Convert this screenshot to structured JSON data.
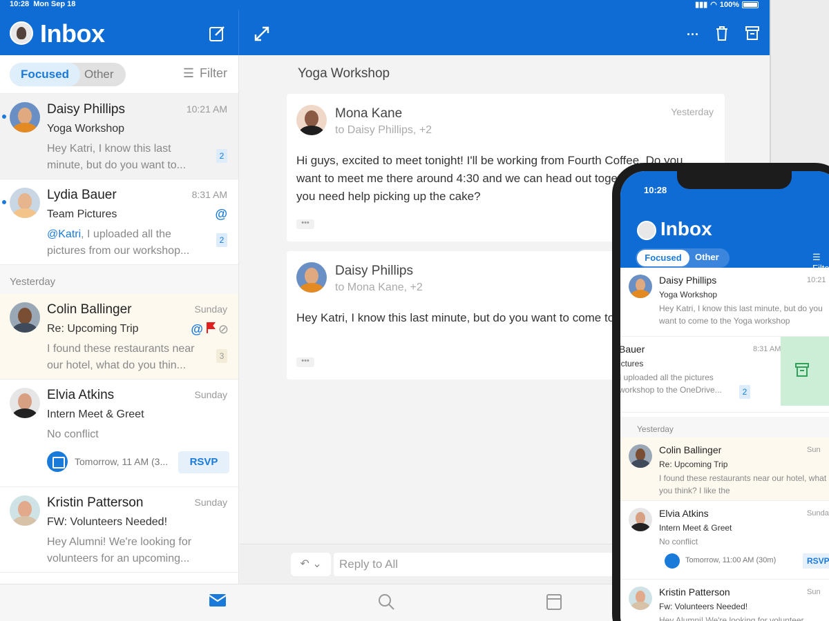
{
  "tablet": {
    "status": {
      "time": "10:28",
      "date": "Mon Sep 18",
      "battery": "100%"
    },
    "header": {
      "title": "Inbox"
    },
    "list": {
      "tabs": {
        "focused": "Focused",
        "other": "Other"
      },
      "filter_label": "Filter",
      "messages": [
        {
          "from": "Daisy Phillips",
          "time": "10:21 AM",
          "subject": "Yoga Workshop",
          "preview": "Hey Katri, I know this last minute, but do you want to...",
          "badge": "2"
        },
        {
          "from": "Lydia Bauer",
          "time": "8:31 AM",
          "subject": "Team Pictures",
          "mention": "@Katri",
          "preview": ", I uploaded all the pictures from our workshop...",
          "badge": "2"
        },
        {
          "from": "Colin Ballinger",
          "time": "Sunday",
          "subject": "Re: Upcoming Trip",
          "preview": "I found these restaurants near our hotel, what do you thin...",
          "badge": "3"
        },
        {
          "from": "Elvia Atkins",
          "time": "Sunday",
          "subject": "Intern Meet & Greet",
          "preview": "No conflict",
          "event": "Tomorrow, 11 AM (3...",
          "rsvp": "RSVP"
        },
        {
          "from": "Kristin Patterson",
          "time": "Sunday",
          "subject": "FW: Volunteers Needed!",
          "preview": "Hey Alumni! We're looking for volunteers for an upcoming..."
        }
      ],
      "section_yesterday": "Yesterday"
    },
    "reading": {
      "subject": "Yoga Workshop",
      "messages": [
        {
          "from": "Mona Kane",
          "to": "to Daisy Phillips, +2",
          "time": "Yesterday",
          "body": "Hi guys, excited to meet tonight! I'll be working from Fourth Coffee. Do you want to meet me there around 4:30 and we can head out together? @Cecil, do you need help picking up the cake?"
        },
        {
          "from": "Daisy Phillips",
          "to": "to Mona Kane, +2",
          "body": "Hey Katri, I know this last minute, but do you want to come to yoga with us?"
        }
      ],
      "more": "•••",
      "reply_placeholder": "Reply to All"
    }
  },
  "phone": {
    "status": {
      "time": "10:28"
    },
    "title": "Inbox",
    "tabs": {
      "focused": "Focused",
      "other": "Other"
    },
    "filter_label": "Filter",
    "messages": [
      {
        "from": "Daisy Phillips",
        "time": "10:21",
        "subject": "Yoga Workshop",
        "preview": "Hey Katri, I know this last minute, but do you want to come to the Yoga workshop"
      },
      {
        "from": "Bauer",
        "time": "8:31 AM",
        "subject": "ictures",
        "preview": "I uploaded all the pictures workshop to the OneDrive...",
        "badge": "2"
      },
      {
        "from": "Colin Ballinger",
        "time": "Sun",
        "subject": "Re: Upcoming Trip",
        "preview": "I found these restaurants near our hotel, what do you think? I like the"
      },
      {
        "from": "Elvia Atkins",
        "time": "Sunday",
        "subject": "Intern Meet & Greet",
        "preview": "No conflict",
        "event": "Tomorrow, 11:00 AM (30m)",
        "rsvp": "RSVP"
      },
      {
        "from": "Kristin Patterson",
        "time": "Sun",
        "subject": "Fw: Volunteers Needed!",
        "preview": "Hey Alumni! We're looking for volunteer"
      }
    ],
    "section_yesterday": "Yesterday"
  },
  "colors": {
    "brand": "#0f6cd4",
    "accent": "#1a7ad9",
    "flag": "#e02020",
    "swipe": "#cdeed6"
  }
}
